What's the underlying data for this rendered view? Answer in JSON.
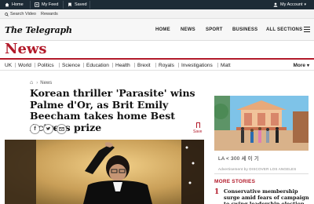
{
  "topbar": {
    "home": "Home",
    "my_feed": "My Feed",
    "saved": "Saved",
    "account": "My Account"
  },
  "subbar": {
    "search": "Search",
    "video": "Video",
    "rewards": "Rewards"
  },
  "masthead": {
    "logo": "The Telegraph",
    "nav": [
      "HOME",
      "NEWS",
      "SPORT",
      "BUSINESS",
      "ALL SECTIONS"
    ]
  },
  "section": {
    "title": "News",
    "nav": [
      "UK",
      "World",
      "Politics",
      "Science",
      "Education",
      "Health",
      "Brexit",
      "Royals",
      "Investigations",
      "Matt"
    ],
    "more": "More"
  },
  "article": {
    "breadcrumb": "News",
    "headline": "Korean thriller 'Parasite' wins Palme d'Or, as Brit Emily Beecham takes home Best Actress prize",
    "save_label": "Save"
  },
  "ad": {
    "caption": "LA < 300 세 이 기",
    "advertisement": "Advertisement by DISCOVER LOS ANGELES"
  },
  "more_stories": {
    "heading": "MORE STORIES",
    "items": [
      {
        "number": "1",
        "text": "Conservative membership surge amid fears of campaign to swing leadership election"
      }
    ]
  },
  "colors": {
    "brand_red": "#b21a2a",
    "topbar_bg": "#1d2b36"
  }
}
